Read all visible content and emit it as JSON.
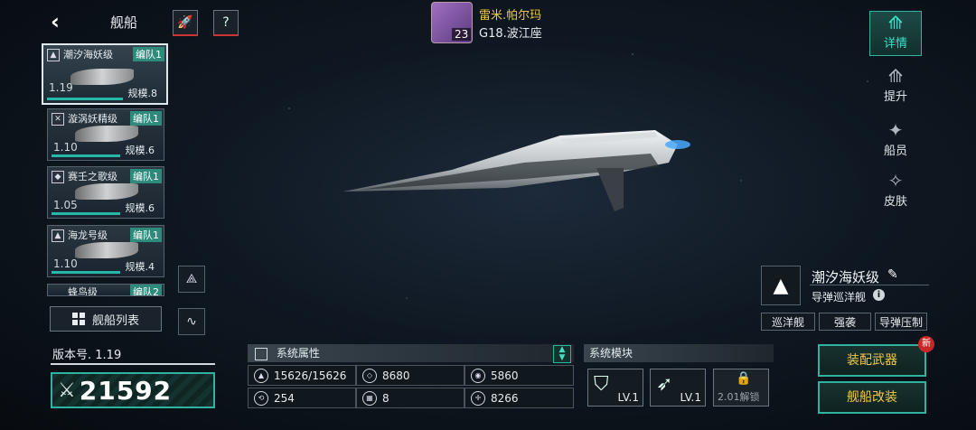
{
  "header": {
    "back_icon": "back-arrow-icon",
    "title": "舰船",
    "btn1_icon": "rocket-icon",
    "btn2_icon": "question-icon",
    "player": {
      "name": "雷米.帕尔玛",
      "level": "23",
      "zone": "G18.波江座"
    }
  },
  "ship_list": [
    {
      "name": "潮汐海妖级",
      "team": "编队1",
      "version": "1.19",
      "scale": "规模.8"
    },
    {
      "name": "漩涡妖精级",
      "team": "编队1",
      "version": "1.10",
      "scale": "规模.6"
    },
    {
      "name": "赛壬之歌级",
      "team": "编队1",
      "version": "1.05",
      "scale": "规模.6"
    },
    {
      "name": "海龙号级",
      "team": "编队1",
      "version": "1.10",
      "scale": "规模.4"
    },
    {
      "name": "蜂鸟级",
      "team": "编队2"
    }
  ],
  "fleet_list_label": "舰船列表",
  "version_label": "版本号. 1.19",
  "power": "21592",
  "tabs": [
    {
      "label": "详情",
      "icon": "ship-detail-icon",
      "active": true
    },
    {
      "label": "提升",
      "icon": "upgrade-icon",
      "active": false
    },
    {
      "label": "船员",
      "icon": "crew-icon",
      "active": false
    },
    {
      "label": "皮肤",
      "icon": "skin-icon",
      "active": false
    }
  ],
  "ship_info": {
    "name": "潮汐海妖级",
    "type": "导弹巡洋舰",
    "tags": [
      "巡洋舰",
      "强袭",
      "导弹压制"
    ]
  },
  "attributes": {
    "title": "系统属性",
    "rows": [
      [
        "15626/15626",
        "8680",
        "5860"
      ],
      [
        "254",
        "8",
        "8266"
      ]
    ]
  },
  "modules": {
    "title": "系统模块",
    "slots": [
      {
        "level": "LV.1",
        "icon": "shield-icon"
      },
      {
        "level": "LV.1",
        "icon": "missile-icon"
      },
      {
        "level": "2.01解锁",
        "icon": "lock-icon"
      }
    ]
  },
  "actions": {
    "equip_label": "装配武器",
    "refit_label": "舰船改装",
    "new_badge": "新"
  },
  "colors": {
    "accent": "#2fb3a0",
    "gold": "#f0c848",
    "alert": "#c62828"
  }
}
